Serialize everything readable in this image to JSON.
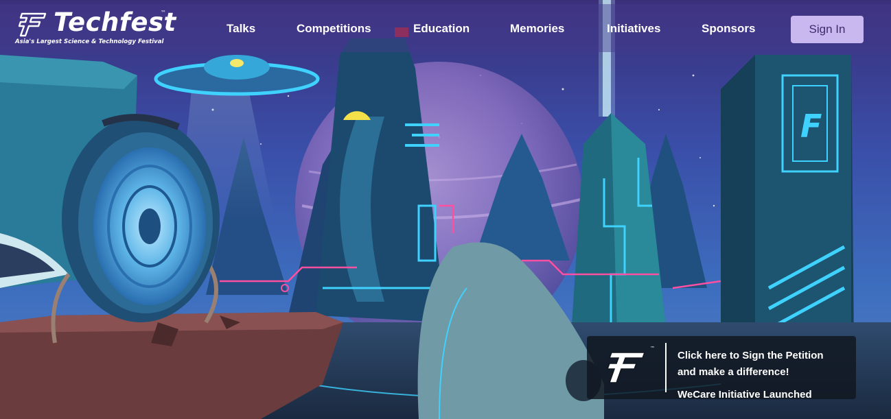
{
  "brand": {
    "name": "Techfest",
    "trademark": "™",
    "tagline": "Asia's Largest Science & Technology Festival"
  },
  "nav": {
    "items": [
      {
        "label": "Talks"
      },
      {
        "label": "Competitions"
      },
      {
        "label": "Education"
      },
      {
        "label": "Memories"
      },
      {
        "label": "Initiatives"
      },
      {
        "label": "Sponsors"
      }
    ],
    "signin_label": "Sign In"
  },
  "petition": {
    "line1": "Click here to Sign the Petition",
    "line2": "and make a difference!",
    "line3": "WeCare Initiative Launched",
    "trademark": "™"
  },
  "colors": {
    "nav_overlay": "#443a8c",
    "signin_bg": "#c9b7ef",
    "signin_text": "#3d2b6e",
    "neon_cyan": "#3fd2ff",
    "neon_pink": "#ff4fa0",
    "sky_top": "#2a3a8a",
    "sky_bottom": "#1c5b9a"
  },
  "icons": {
    "brand_logo": "tf-logo-icon",
    "petition_logo": "tf-logo-icon"
  }
}
